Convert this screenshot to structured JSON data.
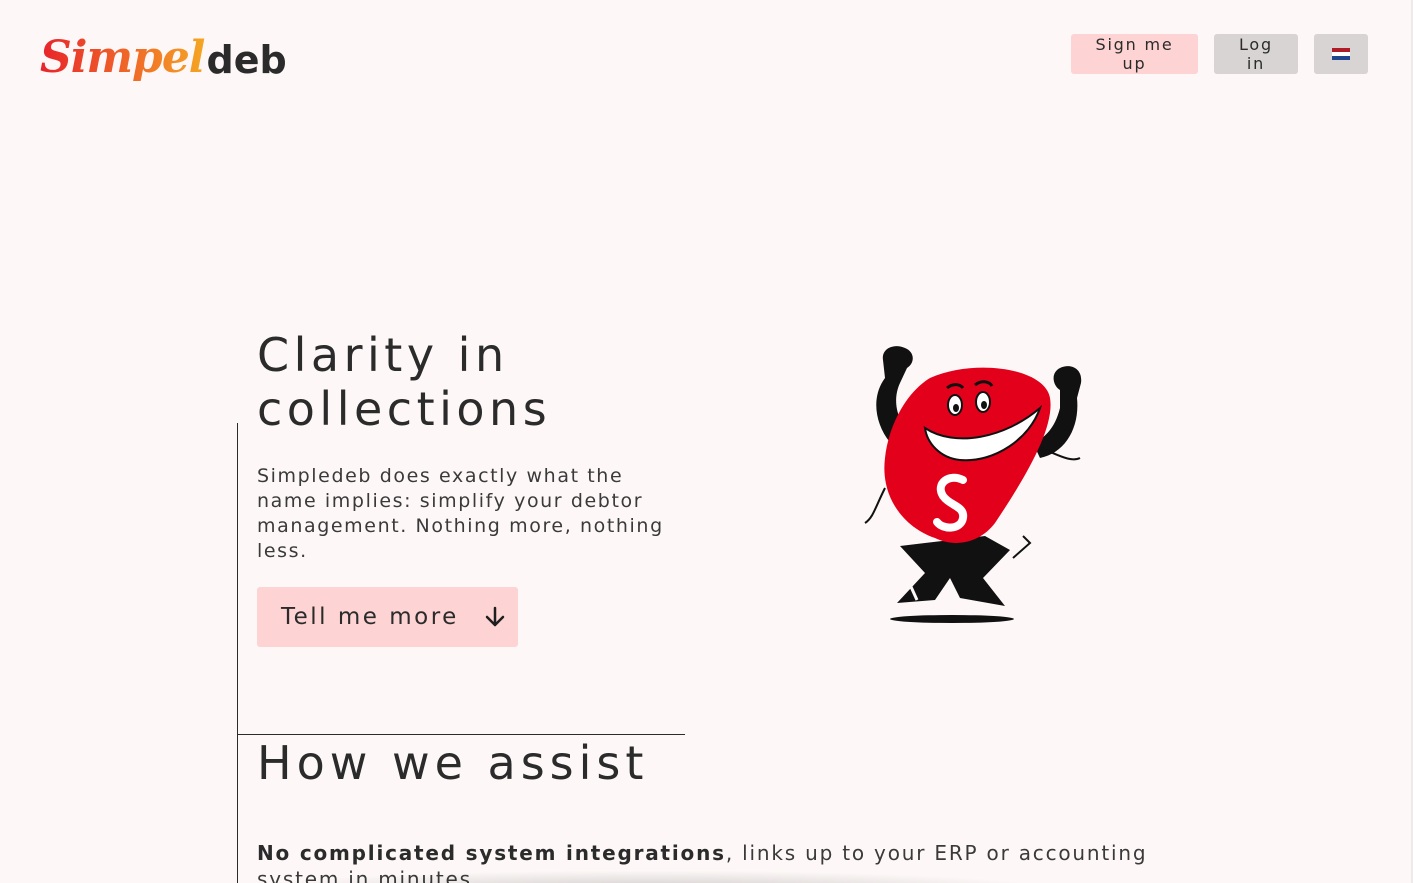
{
  "brand": {
    "logo_part1": "Simpel",
    "logo_part2": "deb"
  },
  "nav": {
    "signup_label": "Sign me up",
    "login_label": "Log in",
    "language_icon": "netherlands-flag-icon"
  },
  "hero": {
    "title": "Clarity in collections",
    "text": "Simpledeb does exactly what the name implies: simplify your debtor management. Nothing more, nothing less.",
    "cta_label": "Tell me more",
    "cta_icon": "arrow-down-icon",
    "mascot": "mascot-illustration"
  },
  "assist": {
    "title": "How we assist",
    "point_bold": "No complicated system integrations",
    "point_rest": ", links up to your ERP or accounting system in minutes."
  },
  "colors": {
    "background": "#fdf8f7",
    "primary_button": "#fdd3d3",
    "secondary_button": "#d7d4d3",
    "brand_red": "#e8232b",
    "brand_orange": "#f5a623",
    "mascot_red": "#e3001b"
  }
}
